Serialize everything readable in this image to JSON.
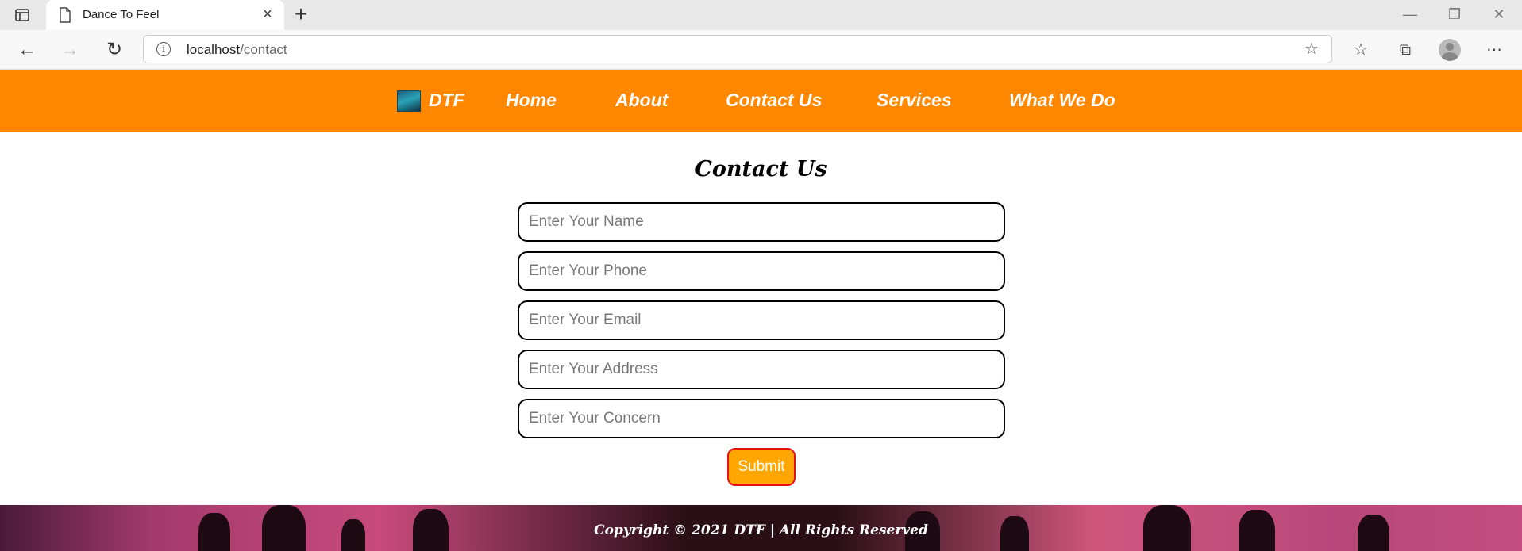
{
  "browser": {
    "tab_title": "Dance To Feel",
    "url_host": "localhost",
    "url_path": "/contact"
  },
  "nav": {
    "brand": "DTF",
    "links": [
      "Home",
      "About",
      "Contact Us",
      "Services",
      "What We Do"
    ],
    "bg_color": "#ff8800"
  },
  "form": {
    "title": "Contact Us",
    "fields": [
      {
        "placeholder": "Enter Your Name",
        "value": ""
      },
      {
        "placeholder": "Enter Your Phone",
        "value": ""
      },
      {
        "placeholder": "Enter Your Email",
        "value": ""
      },
      {
        "placeholder": "Enter Your Address",
        "value": ""
      },
      {
        "placeholder": "Enter Your Concern",
        "value": ""
      }
    ],
    "submit_label": "Submit",
    "submit_color": "#ffa600"
  },
  "footer": {
    "text": "Copyright © 2021 DTF | All Rights Reserved"
  }
}
